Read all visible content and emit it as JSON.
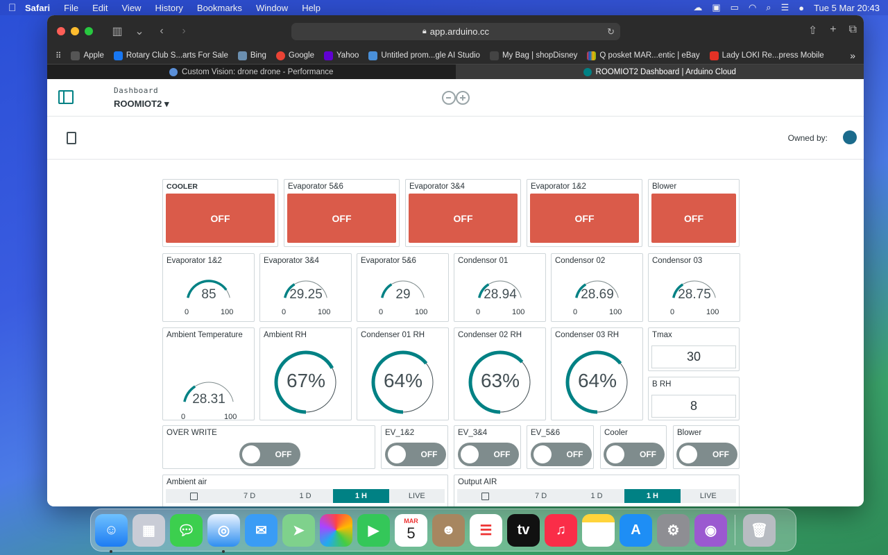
{
  "menubar": {
    "app": "Safari",
    "items": [
      "File",
      "Edit",
      "View",
      "History",
      "Bookmarks",
      "Window",
      "Help"
    ],
    "clock": "Tue 5 Mar  20:43"
  },
  "browser": {
    "url": "app.arduino.cc",
    "bookmarks": [
      "Apple",
      "Rotary Club S...arts For Sale",
      "Bing",
      "Google",
      "Yahoo",
      "Untitled prom...gle AI Studio",
      "My Bag | shopDisney",
      "Q posket MAR...entic | eBay",
      "Lady LOKI Re...press Mobile"
    ],
    "tabs": [
      {
        "title": "Custom Vision: drone drone - Performance"
      },
      {
        "title": "ROOMIOT2 Dashboard | Arduino Cloud"
      }
    ]
  },
  "header": {
    "breadcrumb": "Dashboard",
    "thing": "ROOMIOT2 ▾",
    "owned_by": "Owned by:"
  },
  "push_buttons": [
    {
      "title": "COOLER",
      "state": "OFF"
    },
    {
      "title": "Evaporator 5&6",
      "state": "OFF"
    },
    {
      "title": "Evaporator 3&4",
      "state": "OFF"
    },
    {
      "title": "Evaporator 1&2",
      "state": "OFF"
    },
    {
      "title": "Blower",
      "state": "OFF"
    }
  ],
  "gauges": [
    {
      "title": "Evaporator 1&2",
      "value": "85",
      "min": "0",
      "max": "100",
      "fraction": 0.85
    },
    {
      "title": "Evaporator 3&4",
      "value": "29.25",
      "min": "0",
      "max": "100",
      "fraction": 0.2925
    },
    {
      "title": "Evaporator 5&6",
      "value": "29",
      "min": "0",
      "max": "100",
      "fraction": 0.29
    },
    {
      "title": "Condensor 01",
      "value": "28.94",
      "min": "0",
      "max": "100",
      "fraction": 0.2894
    },
    {
      "title": "Condensor 02",
      "value": "28.69",
      "min": "0",
      "max": "100",
      "fraction": 0.2869
    },
    {
      "title": "Condensor 03",
      "value": "28.75",
      "min": "0",
      "max": "100",
      "fraction": 0.2875
    }
  ],
  "ambient_temp": {
    "title": "Ambient Temperature",
    "value": "28.31",
    "min": "0",
    "max": "100",
    "fraction": 0.2831
  },
  "percentages": [
    {
      "title": "Ambient RH",
      "value": "67%",
      "fraction": 0.67
    },
    {
      "title": "Condenser 01 RH",
      "value": "64%",
      "fraction": 0.64
    },
    {
      "title": "Condenser 02 RH",
      "value": "63%",
      "fraction": 0.63
    },
    {
      "title": "Condenser 03 RH",
      "value": "64%",
      "fraction": 0.64
    }
  ],
  "values": [
    {
      "title": "Tmax",
      "value": "30"
    },
    {
      "title": "B RH",
      "value": "8"
    }
  ],
  "switches": [
    {
      "title": "OVER WRITE",
      "state": "OFF"
    },
    {
      "title": "EV_1&2",
      "state": "OFF"
    },
    {
      "title": "EV_3&4",
      "state": "OFF"
    },
    {
      "title": "EV_5&6",
      "state": "OFF"
    },
    {
      "title": "Cooler",
      "state": "OFF"
    },
    {
      "title": "Blower",
      "state": "OFF"
    }
  ],
  "charts": [
    {
      "title": "Ambient air",
      "ranges": [
        "7 D",
        "1 D",
        "1 H",
        "LIVE"
      ],
      "selected": "1 H"
    },
    {
      "title": "Output AIR",
      "ranges": [
        "7 D",
        "1 D",
        "1 H",
        "LIVE"
      ],
      "selected": "1 H"
    }
  ],
  "colors": {
    "accent": "#008184",
    "push_off": "#da5b4a",
    "switch_off": "#7f8c8d"
  },
  "dock": {
    "calendar_month": "MAR",
    "calendar_day": "5"
  }
}
